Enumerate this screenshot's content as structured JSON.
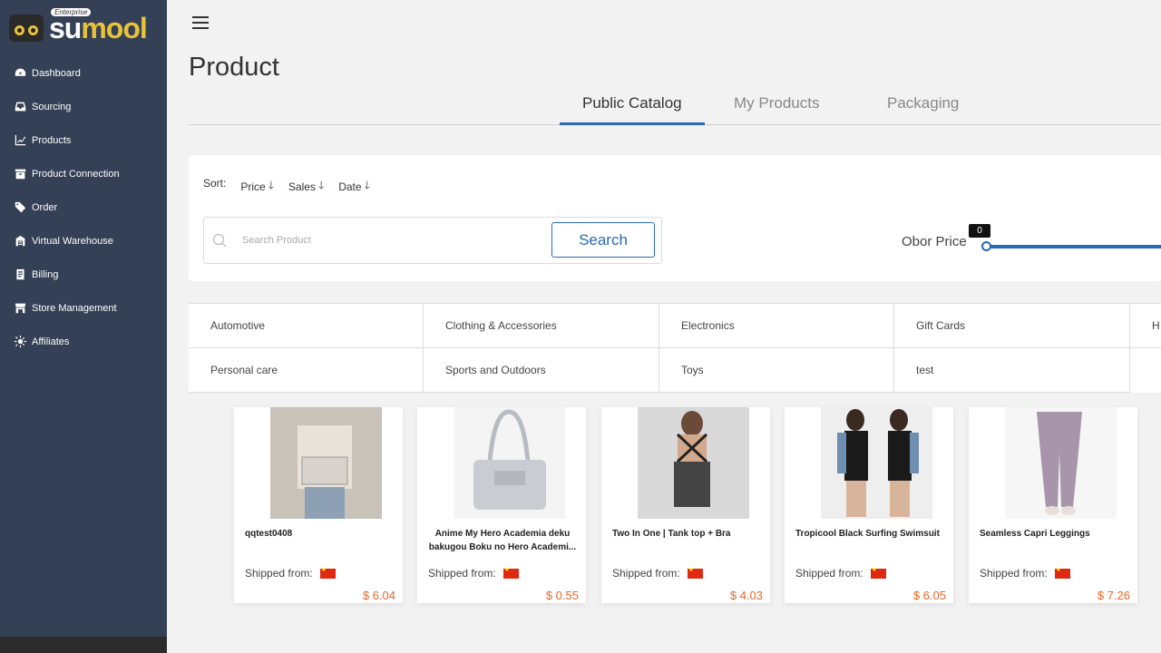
{
  "app": {
    "logo_word_su": "su",
    "logo_word_mool": "mool",
    "logo_badge": "Enterprise"
  },
  "sidebar": {
    "items": [
      {
        "label": "Dashboard",
        "icon": "dashboard-icon"
      },
      {
        "label": "Sourcing",
        "icon": "inbox-icon"
      },
      {
        "label": "Products",
        "icon": "chart-line-icon"
      },
      {
        "label": "Product Connection",
        "icon": "archive-icon"
      },
      {
        "label": "Order",
        "icon": "tag-icon"
      },
      {
        "label": "Virtual Warehouse",
        "icon": "warehouse-icon"
      },
      {
        "label": "Billing",
        "icon": "billing-icon"
      },
      {
        "label": "Store Management",
        "icon": "store-icon"
      },
      {
        "label": "Affiliates",
        "icon": "sun-icon"
      }
    ]
  },
  "page": {
    "title": "Product",
    "tabs": [
      {
        "label": "Public Catalog",
        "active": true
      },
      {
        "label": "My Products",
        "active": false
      },
      {
        "label": "Packaging",
        "active": false
      }
    ]
  },
  "filters": {
    "sort_label": "Sort:",
    "sort_options": [
      "Price",
      "Sales",
      "Date"
    ],
    "search_placeholder": "Search Product",
    "search_button": "Search",
    "obor_price_label": "Obor Price",
    "obor_price_min": "0"
  },
  "categories": [
    "Automotive",
    "Clothing & Accessories",
    "Electronics",
    "Gift Cards",
    "H",
    "Personal care",
    "Sports and Outdoors",
    "Toys",
    "test"
  ],
  "products": [
    {
      "name": "qqtest0408",
      "shipped_label": "Shipped from:",
      "price": "$ 6.04"
    },
    {
      "name": "Anime My Hero Academia deku bakugou Boku no Hero Academi...",
      "shipped_label": "Shipped from:",
      "price": "$ 0.55"
    },
    {
      "name": "Two In One | Tank top + Bra",
      "shipped_label": "Shipped from:",
      "price": "$ 4.03"
    },
    {
      "name": "Tropicool Black Surfing Swimsuit",
      "shipped_label": "Shipped from:",
      "price": "$ 6.05"
    },
    {
      "name": "Seamless Capri Leggings",
      "shipped_label": "Shipped from:",
      "price": "$ 7.26"
    }
  ],
  "colors": {
    "sidebar_bg": "#344055",
    "accent": "#2a6ab4",
    "price": "#e8662a"
  }
}
